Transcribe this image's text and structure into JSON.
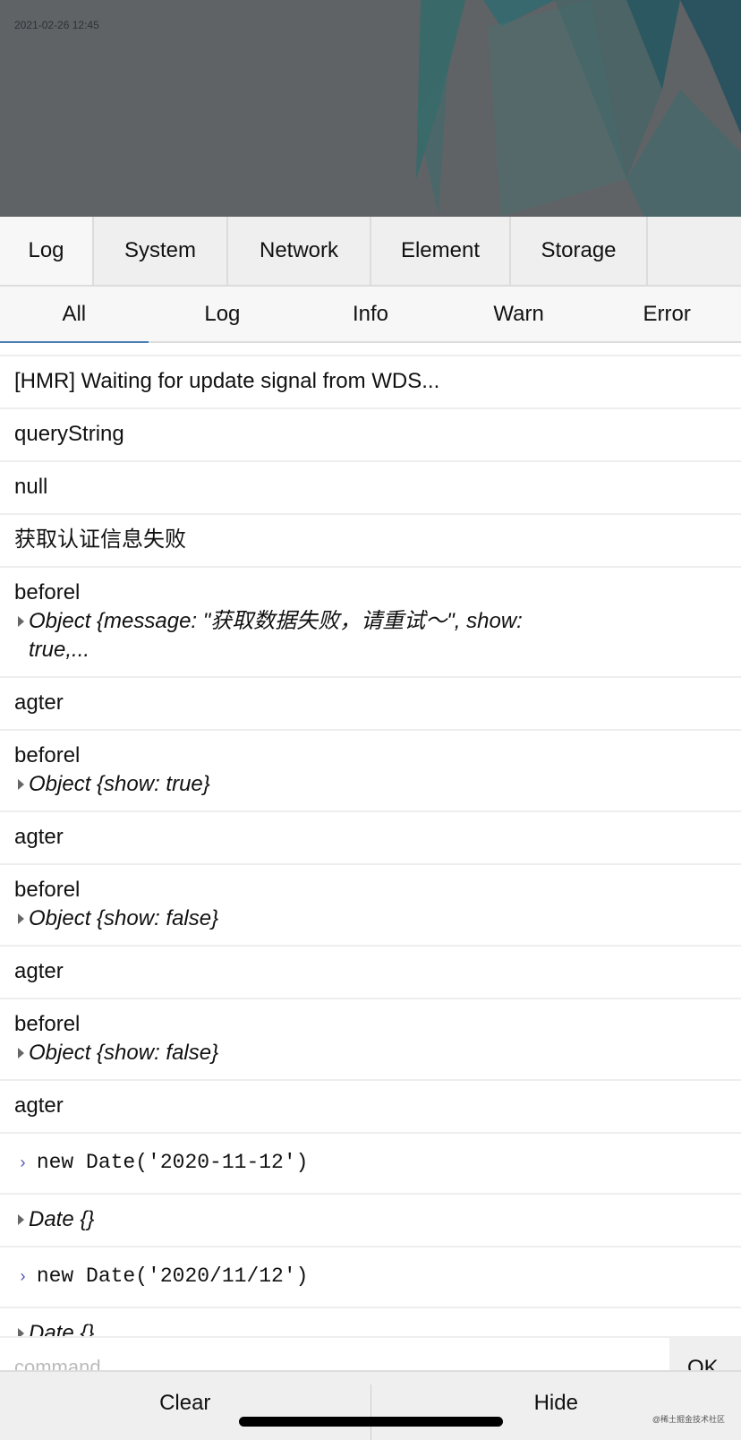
{
  "header": {
    "timestamp": "2021-02-26 12:45"
  },
  "tabs": [
    {
      "label": "Log",
      "active": true
    },
    {
      "label": "System"
    },
    {
      "label": "Network"
    },
    {
      "label": "Element"
    },
    {
      "label": "Storage"
    }
  ],
  "subtabs": [
    {
      "label": "All",
      "active": true
    },
    {
      "label": "Log"
    },
    {
      "label": "Info"
    },
    {
      "label": "Warn"
    },
    {
      "label": "Error"
    }
  ],
  "logs": {
    "l0": "[HMR] Waiting for update signal from WDS...",
    "l1": "queryString",
    "l2": "null",
    "l3": "获取认证信息失败",
    "l4": "beforel",
    "l4obj": "Object {message: \"获取数据失败，请重试～\", show: true,...",
    "l5": "agter",
    "l6": "beforel",
    "l6obj": "Object {show: true}",
    "l7": "agter",
    "l8": "beforel",
    "l8obj": "Object {show: false}",
    "l9": "agter",
    "l10": "beforel",
    "l10obj": "Object {show: false}",
    "l11": "agter",
    "c1": "new Date('2020-11-12')",
    "r1": "Date {}",
    "c2": "new Date('2020/11/12')",
    "r2": "Date {}"
  },
  "command": {
    "placeholder": "command",
    "ok_label": "OK"
  },
  "toolbar": {
    "clear_label": "Clear",
    "hide_label": "Hide"
  },
  "watermark": "@稀土掘金技术社区",
  "colors": {
    "accent": "#4a7fb5",
    "prompt": "#5757b8"
  }
}
